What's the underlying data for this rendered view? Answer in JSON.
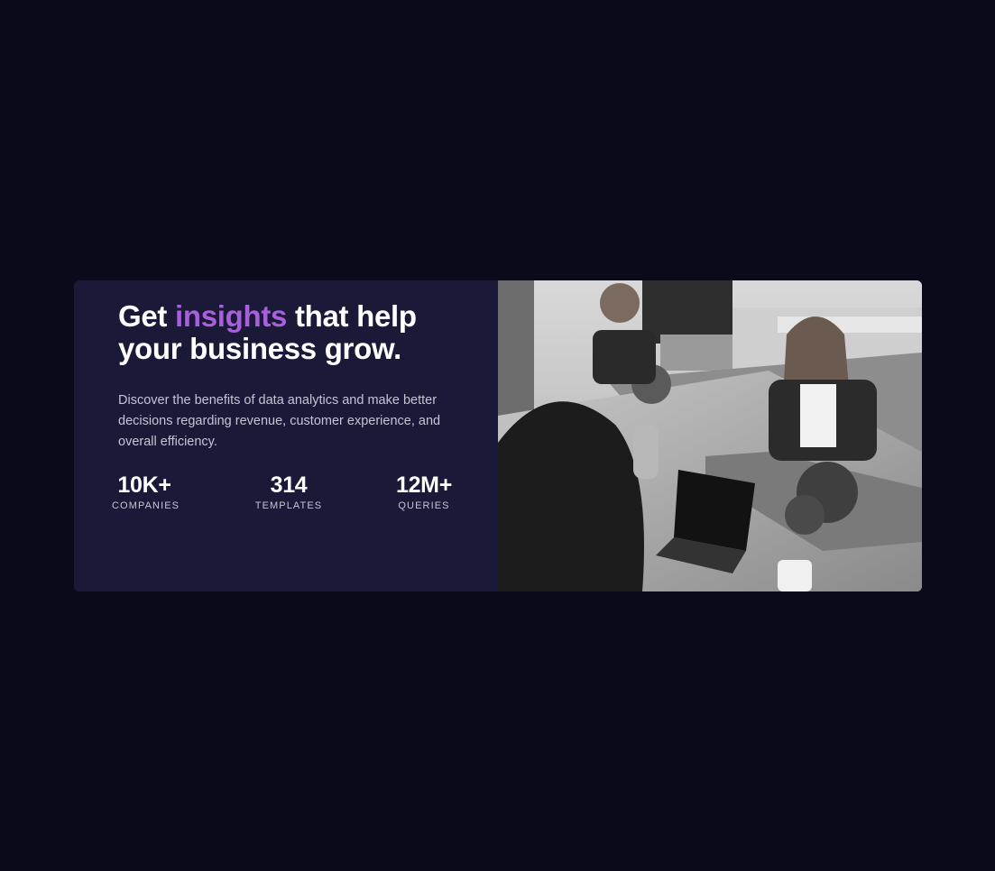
{
  "hero": {
    "title_before": "Get ",
    "title_accent": "insights",
    "title_after": " that help your business grow.",
    "description": "Discover the benefits of data analytics and make better decisions regarding revenue, customer experience, and overall efficiency."
  },
  "stats": [
    {
      "value": "10K+",
      "label": "COMPANIES"
    },
    {
      "value": "314",
      "label": "TEMPLATES"
    },
    {
      "value": "12M+",
      "label": "QUERIES"
    }
  ],
  "image": {
    "subject": "office-team-photo"
  },
  "colors": {
    "page_background": "#090b1a",
    "card_background": "#1b1938",
    "accent": "#a75fdc",
    "heading": "#ffffff",
    "body_text": "#c6c4d3"
  }
}
